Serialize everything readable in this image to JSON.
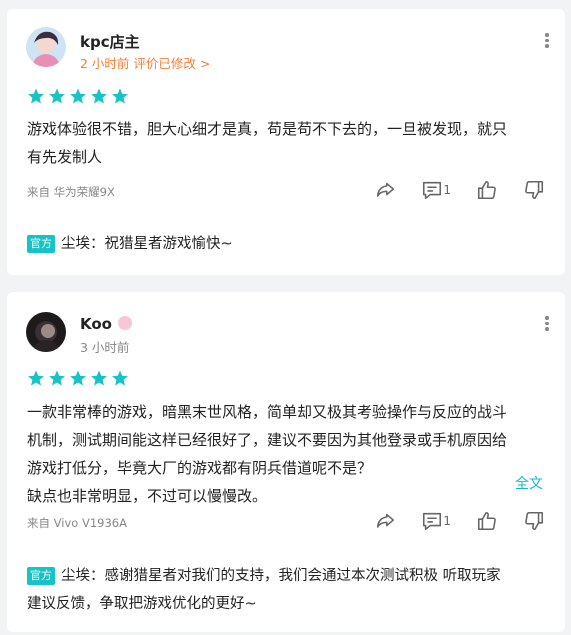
{
  "reviews": [
    {
      "username": "kpc店主",
      "time": "2 小时前 评价已修改 >",
      "rating": 5,
      "content_lines": [
        "游戏体验很不错，胆大心细才是真，苟是苟不下去的，一旦被发现，就只",
        "有先发制人"
      ],
      "device": "来自 华为荣耀9X",
      "reply_count": "1",
      "official_badge": "官方",
      "official_reply_lines": [
        "尘埃：祝猎星者游戏愉快~"
      ]
    },
    {
      "username": "Koo",
      "time": "3 小时前",
      "rating": 5,
      "content_lines": [
        "一款非常棒的游戏，暗黑末世风格，简单却又极其考验操作与反应的战斗",
        "机制，测试期间能这样已经很好了，建议不要因为其他登录或手机原因给",
        "游戏打低分，毕竟大厂的游戏都有阴兵借道呢不是？",
        "缺点也非常明显，不过可以慢慢改。"
      ],
      "full_text_label": "全文",
      "device": "来自 Vivo V1936A",
      "reply_count": "1",
      "official_badge": "官方",
      "official_reply_lines": [
        "尘埃：感谢猎星者对我们的支持，我们会通过本次测试积极 听取玩家",
        "建议反馈，争取把游戏优化的更好~"
      ]
    }
  ],
  "colors": {
    "star": "#17c3c4",
    "accent": "#14b9c8",
    "edited": "#f0803c",
    "icon": "#666666"
  }
}
